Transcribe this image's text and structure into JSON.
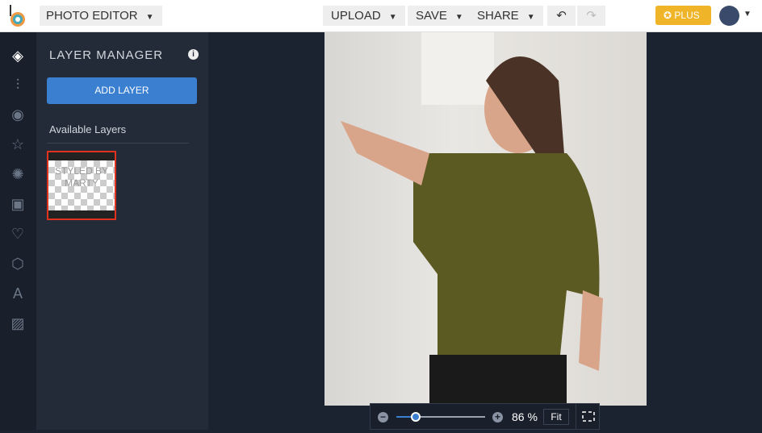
{
  "header": {
    "app_title": "PHOTO EDITOR",
    "upload": "UPLOAD",
    "save": "SAVE",
    "share": "SHARE",
    "plus": "PLUS"
  },
  "panel": {
    "title": "LAYER MANAGER",
    "add_layer": "ADD LAYER",
    "available_layers": "Available Layers",
    "layer_thumb_text": "STYLED BY MARTY"
  },
  "zoom": {
    "percent": "86 %",
    "fit": "Fit",
    "level_fraction": 0.22
  },
  "colors": {
    "accent": "#3b7fd0",
    "plus": "#f0b429",
    "selected": "#e0321e"
  }
}
